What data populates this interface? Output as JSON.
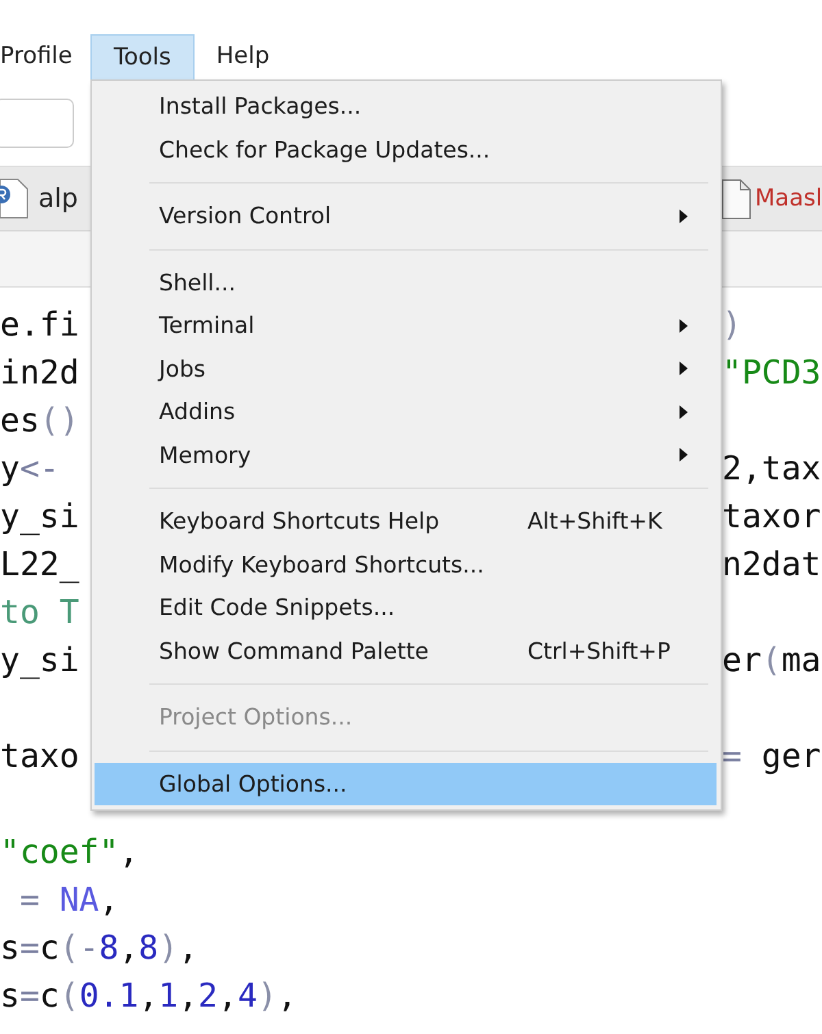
{
  "menubar": [
    {
      "label": "Profile",
      "selected": false
    },
    {
      "label": "Tools",
      "selected": true
    },
    {
      "label": "Help",
      "selected": false
    }
  ],
  "tabs": [
    {
      "label": "alp",
      "kind": "r-script",
      "modified": false
    },
    {
      "label": "Maasl",
      "kind": "file",
      "modified": true
    }
  ],
  "editor": {
    "lines": [
      {
        "kind": "code",
        "left": [
          {
            "text": "e.fi",
            "kind": "plain"
          }
        ],
        "right": [
          {
            "text": ")",
            "kind": "paren"
          }
        ]
      },
      {
        "kind": "code",
        "left": [
          {
            "text": "in2d",
            "kind": "plain"
          }
        ],
        "right": [
          {
            "text": "\"PCD3",
            "kind": "string"
          }
        ]
      },
      {
        "kind": "code",
        "left": [
          {
            "text": "es",
            "kind": "plain"
          },
          {
            "text": "()",
            "kind": "paren"
          }
        ]
      },
      {
        "kind": "code",
        "left": [
          {
            "text": "y",
            "kind": "plain"
          },
          {
            "text": "<-",
            "kind": "operator"
          }
        ],
        "right": [
          {
            "text": "2,tax",
            "kind": "plain"
          }
        ]
      },
      {
        "kind": "code",
        "left": [
          {
            "text": "y_si",
            "kind": "plain"
          }
        ],
        "right": [
          {
            "text": "taxor",
            "kind": "plain"
          }
        ]
      },
      {
        "kind": "code",
        "left": [
          {
            "text": "L22_",
            "kind": "plain"
          }
        ],
        "right": [
          {
            "text": "n2dat",
            "kind": "plain"
          }
        ]
      },
      {
        "kind": "code",
        "left": [
          {
            "text": "to T",
            "kind": "comment"
          }
        ]
      },
      {
        "kind": "code",
        "left": [
          {
            "text": "y_si",
            "kind": "plain"
          }
        ],
        "right": [
          {
            "text": "er",
            "kind": "plain"
          },
          {
            "text": "(",
            "kind": "paren"
          },
          {
            "text": "ma",
            "kind": "plain"
          }
        ]
      },
      {
        "kind": "blank"
      },
      {
        "kind": "code",
        "left": [
          {
            "text": "taxo",
            "kind": "plain"
          }
        ],
        "right": [
          {
            "text": "=",
            "kind": "operator"
          },
          {
            "text": " ger",
            "kind": "plain"
          }
        ]
      },
      {
        "kind": "blank"
      },
      {
        "kind": "code",
        "left": [
          {
            "text": "\"coef\"",
            "kind": "string"
          },
          {
            "text": ",",
            "kind": "plain"
          }
        ]
      },
      {
        "kind": "code",
        "left": [
          {
            "text": " = ",
            "kind": "operator"
          },
          {
            "text": "NA",
            "kind": "constant"
          },
          {
            "text": ",",
            "kind": "plain"
          }
        ]
      },
      {
        "kind": "code",
        "left": [
          {
            "text": "s",
            "kind": "plain"
          },
          {
            "text": "=",
            "kind": "operator"
          },
          {
            "text": "c",
            "kind": "plain"
          },
          {
            "text": "(",
            "kind": "paren"
          },
          {
            "text": "-",
            "kind": "operator"
          },
          {
            "text": "8",
            "kind": "number"
          },
          {
            "text": ",",
            "kind": "plain"
          },
          {
            "text": "8",
            "kind": "number"
          },
          {
            "text": ")",
            "kind": "paren"
          },
          {
            "text": ",",
            "kind": "plain"
          }
        ]
      },
      {
        "kind": "code",
        "left": [
          {
            "text": "s",
            "kind": "plain"
          },
          {
            "text": "=",
            "kind": "operator"
          },
          {
            "text": "c",
            "kind": "plain"
          },
          {
            "text": "(",
            "kind": "paren"
          },
          {
            "text": "0.1",
            "kind": "number"
          },
          {
            "text": ",",
            "kind": "plain"
          },
          {
            "text": "1",
            "kind": "number"
          },
          {
            "text": ",",
            "kind": "plain"
          },
          {
            "text": "2",
            "kind": "number"
          },
          {
            "text": ",",
            "kind": "plain"
          },
          {
            "text": "4",
            "kind": "number"
          },
          {
            "text": ")",
            "kind": "paren"
          },
          {
            "text": ",",
            "kind": "plain"
          }
        ]
      }
    ]
  },
  "menu": [
    {
      "kind": "item",
      "label": "Install Packages...",
      "submenu": false,
      "disabled": false,
      "selected": false
    },
    {
      "kind": "item",
      "label": "Check for Package Updates...",
      "submenu": false,
      "disabled": false,
      "selected": false
    },
    {
      "kind": "separator"
    },
    {
      "kind": "item",
      "label": "Version Control",
      "submenu": true,
      "disabled": false,
      "selected": false
    },
    {
      "kind": "separator"
    },
    {
      "kind": "item",
      "label": "Shell...",
      "submenu": false,
      "disabled": false,
      "selected": false
    },
    {
      "kind": "item",
      "label": "Terminal",
      "submenu": true,
      "disabled": false,
      "selected": false
    },
    {
      "kind": "item",
      "label": "Jobs",
      "submenu": true,
      "disabled": false,
      "selected": false
    },
    {
      "kind": "item",
      "label": "Addins",
      "submenu": true,
      "disabled": false,
      "selected": false
    },
    {
      "kind": "item",
      "label": "Memory",
      "submenu": true,
      "disabled": false,
      "selected": false
    },
    {
      "kind": "separator"
    },
    {
      "kind": "item",
      "label": "Keyboard Shortcuts Help",
      "shortcut": "Alt+Shift+K",
      "submenu": false,
      "disabled": false,
      "selected": false
    },
    {
      "kind": "item",
      "label": "Modify Keyboard Shortcuts...",
      "submenu": false,
      "disabled": false,
      "selected": false
    },
    {
      "kind": "item",
      "label": "Edit Code Snippets...",
      "submenu": false,
      "disabled": false,
      "selected": false
    },
    {
      "kind": "item",
      "label": "Show Command Palette",
      "shortcut": "Ctrl+Shift+P",
      "submenu": false,
      "disabled": false,
      "selected": false
    },
    {
      "kind": "separator"
    },
    {
      "kind": "item",
      "label": "Project Options...",
      "submenu": false,
      "disabled": true,
      "selected": false
    },
    {
      "kind": "separator"
    },
    {
      "kind": "item",
      "label": "Global Options...",
      "submenu": false,
      "disabled": false,
      "selected": true
    }
  ]
}
